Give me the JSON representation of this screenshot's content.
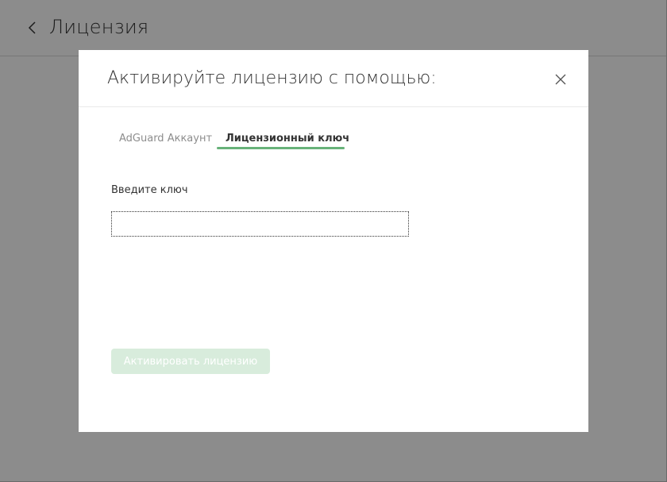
{
  "page": {
    "title": "Лицензия",
    "back_icon": "chevron-left-icon"
  },
  "modal": {
    "title": "Активируйте лицензию с помощью:",
    "close_icon": "close-icon",
    "tabs": [
      {
        "label": "AdGuard Аккаунт",
        "active": false
      },
      {
        "label": "Лицензионный ключ",
        "active": true
      }
    ],
    "key_field": {
      "label": "Введите ключ",
      "value": "",
      "placeholder": ""
    },
    "activate_button": {
      "label": "Активировать лицензию",
      "enabled": false
    }
  },
  "colors": {
    "accent": "#67b279",
    "button_disabled": "#d8ecdc",
    "overlay": "#000000"
  }
}
